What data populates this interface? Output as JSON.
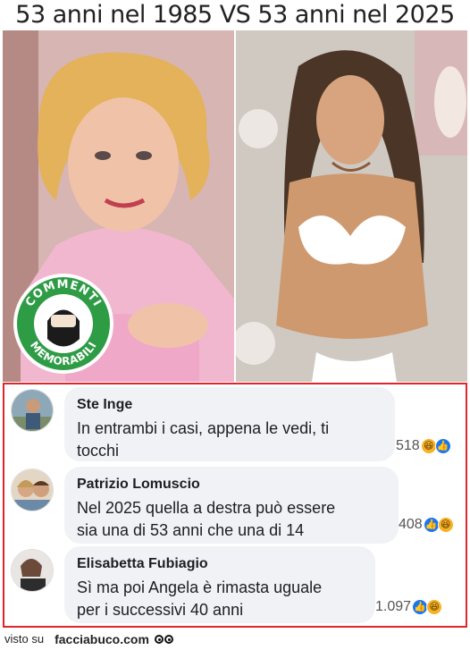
{
  "title": "53 anni nel 1985 VS 53 anni nel 2025",
  "badge": {
    "top_text": "COMMENTI",
    "bottom_text": "MEMORABILI",
    "small_text": "NATI PER IGNORARE",
    "tm": "TM"
  },
  "comments": [
    {
      "author": "Ste Inge",
      "text_lines": [
        "In entrambi i casi, appena le vedi, ti",
        "tocchi"
      ],
      "reaction_count": "518",
      "reactions": [
        "haha",
        "like"
      ]
    },
    {
      "author": "Patrizio Lomuscio",
      "text_lines": [
        "Nel 2025 quella a destra può essere",
        "sia una di 53 anni che una di 14"
      ],
      "reaction_count": "408",
      "reactions": [
        "like",
        "haha"
      ]
    },
    {
      "author": "Elisabetta Fubiagio",
      "text_lines": [
        "Sì ma poi Angela è rimasta uguale",
        "per i successivi 40 anni"
      ],
      "reaction_count": "1.097",
      "reactions": [
        "like",
        "haha"
      ]
    }
  ],
  "footer": {
    "prefix": "visto su",
    "site": "facciabuco.com"
  },
  "colors": {
    "frame_border": "#e0262d",
    "bubble_bg": "#f0f2f5",
    "badge_green": "#2e9b45",
    "like_blue": "#1877f2",
    "haha_yellow": "#f7b125"
  }
}
